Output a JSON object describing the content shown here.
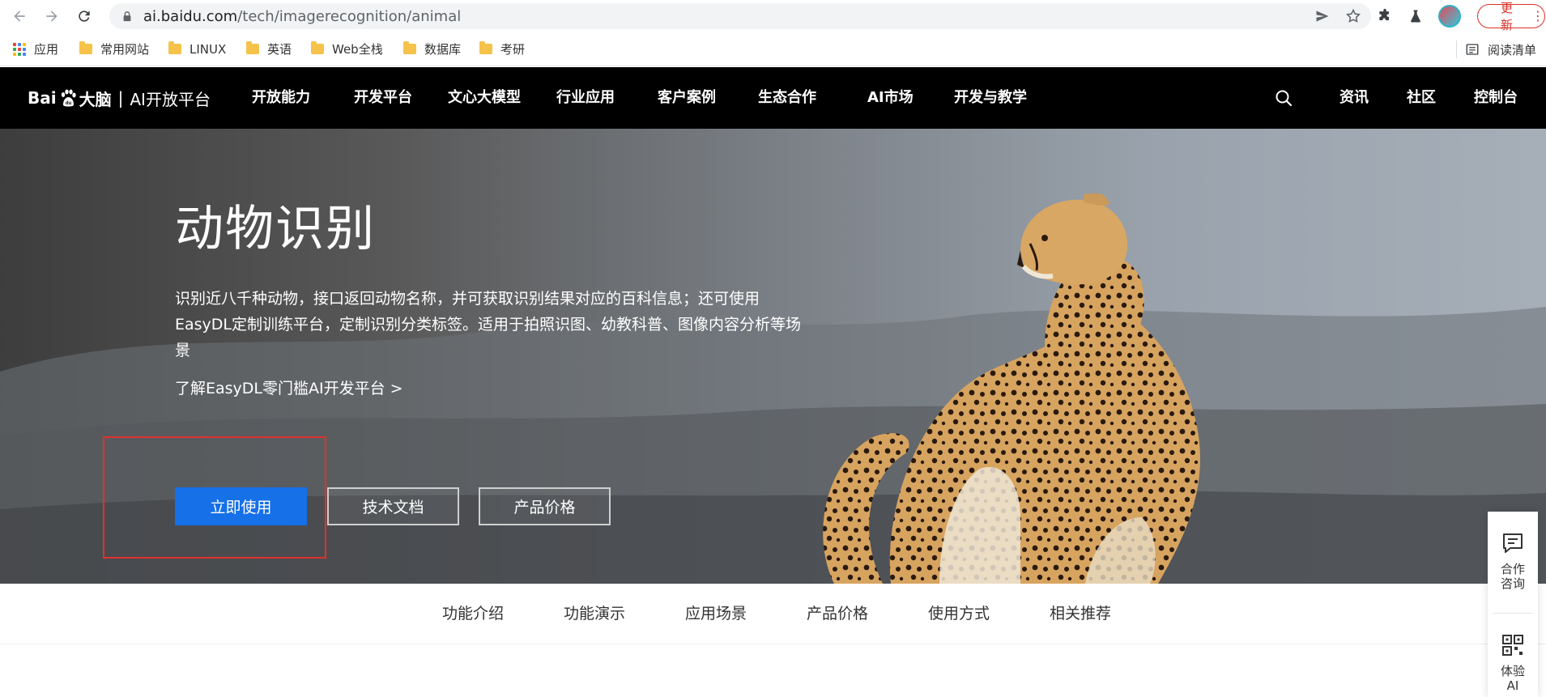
{
  "browser": {
    "url_host": "ai.baidu.com",
    "url_path": "/tech/imagerecognition/animal",
    "update_label": "更新"
  },
  "bookmarks": {
    "apps_label": "应用",
    "items": [
      "常用网站",
      "LINUX",
      "英语",
      "Web全栈",
      "数据库",
      "考研"
    ],
    "reading_list_label": "阅读清单"
  },
  "site_nav": {
    "logo_brand_left": "Bai",
    "logo_brand_right": "大脑",
    "logo_separator": "|",
    "logo_platform": "AI开放平台",
    "items": [
      "开放能力",
      "开发平台",
      "文心大模型",
      "行业应用",
      "客户案例",
      "生态合作",
      "AI市场",
      "开发与教学"
    ],
    "right_items": [
      "资讯",
      "社区",
      "控制台"
    ]
  },
  "hero": {
    "title": "动物识别",
    "description": "识别近八千种动物，接口返回动物名称，并可获取识别结果对应的百科信息；还可使用EasyDL定制训练平台，定制识别分类标签。适用于拍照识图、幼教科普、图像内容分析等场景",
    "link_text": "了解EasyDL零门槛AI开发平台 >",
    "primary_button": "立即使用",
    "doc_button": "技术文档",
    "price_button": "产品价格"
  },
  "subtabs": [
    "功能介绍",
    "功能演示",
    "应用场景",
    "产品价格",
    "使用方式",
    "相关推荐"
  ],
  "side_float": {
    "consult_label": "合作咨询",
    "try_label": "体验AI"
  },
  "colors": {
    "primary_blue": "#1670e8",
    "highlight_red": "#e0312d",
    "nav_background": "#000000"
  }
}
